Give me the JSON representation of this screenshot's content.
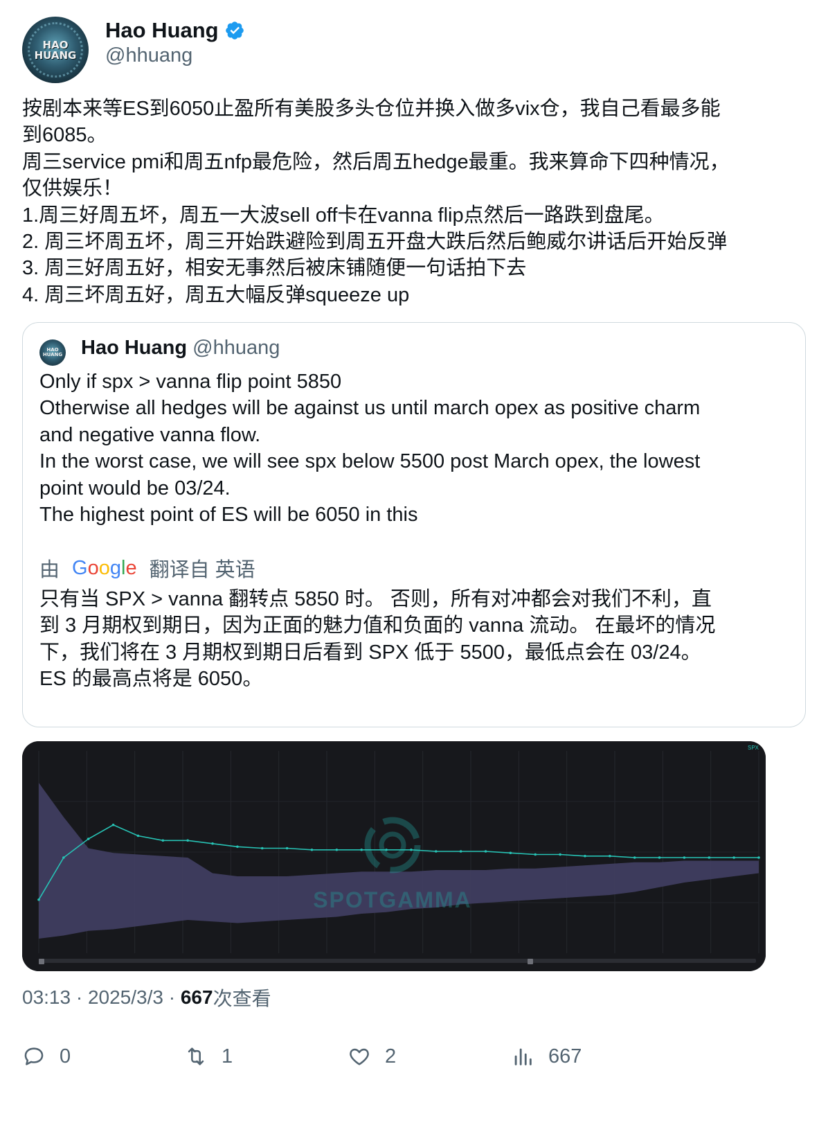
{
  "author": {
    "display_name": "Hao Huang",
    "handle": "@hhuang",
    "avatar_text": "HAO HUANG"
  },
  "tweet": {
    "lines": [
      "按剧本来等ES到6050止盈所有美股多头仓位并换入做多vix仓，我自己看最多能",
      "到6085。",
      "周三service pmi和周五nfp最危险，然后周五hedge最重。我来算命下四种情况，",
      "仅供娱乐！",
      "1.周三好周五坏，周五一大波sell off卡在vanna flip点然后一路跌到盘尾。",
      "2. 周三坏周五坏，周三开始跌避险到周五开盘大跌后然后鲍威尔讲话后开始反弹",
      "3. 周三好周五好，相安无事然后被床铺随便一句话拍下去",
      "4. 周三坏周五好，周五大幅反弹squeeze up"
    ]
  },
  "quote": {
    "display_name": "Hao Huang",
    "handle": "@hhuang",
    "avatar_text": "HAO HUANG",
    "lines": [
      "Only if spx > vanna flip point 5850",
      "Otherwise all hedges will be against us until march opex as positive charm",
      "and negative vanna flow.",
      "In the worst case, we will see spx below 5500 post March opex, the lowest",
      "point would be 03/24.",
      "The highest point of ES will be 6050 in this"
    ],
    "translate_prefix": "由",
    "translate_brand": "Google",
    "translate_suffix": "翻译自 英语",
    "translation_lines": [
      "只有当 SPX > vanna 翻转点 5850 时。 否则，所有对冲都会对我们不利，直",
      "到 3 月期权到期日，因为正面的魅力值和负面的 vanna 流动。 在最坏的情况",
      "下，我们将在 3 月期权到期日后看到 SPX 低于 5500，最低点会在 03/24。",
      "ES 的最高点将是 6050。"
    ]
  },
  "chart_image": {
    "watermark": "SPOTGAMMA",
    "ticker": "SPX",
    "colors": {
      "background": "#17181c",
      "band": "#3f3d60",
      "line": "#27c3b5"
    },
    "chart_data": {
      "type": "area",
      "points": 30,
      "upper": [
        1.0,
        0.78,
        0.58,
        0.55,
        0.54,
        0.53,
        0.52,
        0.42,
        0.4,
        0.4,
        0.4,
        0.41,
        0.42,
        0.43,
        0.43,
        0.43,
        0.44,
        0.44,
        0.44,
        0.45,
        0.45,
        0.46,
        0.47,
        0.48,
        0.49,
        0.49,
        0.5,
        0.5,
        0.5,
        0.5
      ],
      "lower": [
        0.0,
        0.02,
        0.05,
        0.06,
        0.08,
        0.1,
        0.12,
        0.11,
        0.1,
        0.11,
        0.12,
        0.13,
        0.14,
        0.16,
        0.17,
        0.19,
        0.2,
        0.22,
        0.23,
        0.24,
        0.25,
        0.26,
        0.27,
        0.28,
        0.3,
        0.33,
        0.36,
        0.38,
        0.4,
        0.42
      ],
      "line": [
        0.25,
        0.52,
        0.64,
        0.73,
        0.66,
        0.63,
        0.63,
        0.61,
        0.59,
        0.58,
        0.58,
        0.57,
        0.57,
        0.57,
        0.57,
        0.57,
        0.56,
        0.56,
        0.56,
        0.55,
        0.54,
        0.54,
        0.53,
        0.53,
        0.52,
        0.52,
        0.52,
        0.52,
        0.52,
        0.52
      ]
    }
  },
  "meta": {
    "time": "03:13",
    "sep1": "·",
    "date": "2025/3/3",
    "sep2": "·",
    "views_num": "667",
    "views_label": "次查看"
  },
  "actions": {
    "replies": "0",
    "retweets": "1",
    "likes": "2",
    "views": "667"
  }
}
